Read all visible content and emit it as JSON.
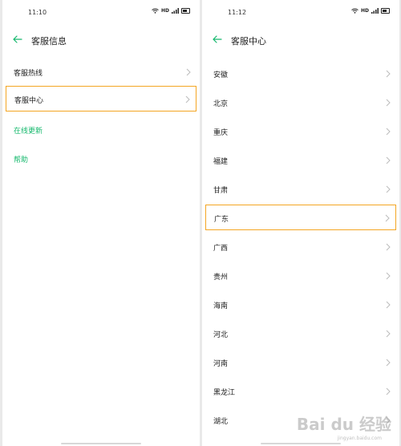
{
  "colors": {
    "accent": "#14b86c",
    "highlight_border": "#f4a623",
    "text": "#222222"
  },
  "left": {
    "status_time": "11:10",
    "status_network": "HD",
    "title": "客服信息",
    "items": [
      {
        "label": "客服热线",
        "chevron": true,
        "green": false
      },
      {
        "label": "客服中心",
        "chevron": true,
        "green": false,
        "highlighted": true
      },
      {
        "label": "在线更新",
        "chevron": false,
        "green": true
      },
      {
        "label": "帮助",
        "chevron": false,
        "green": true
      }
    ]
  },
  "right": {
    "status_time": "11:12",
    "status_network": "HD",
    "title": "客服中心",
    "items": [
      {
        "label": "安徽"
      },
      {
        "label": "北京"
      },
      {
        "label": "重庆"
      },
      {
        "label": "福建"
      },
      {
        "label": "甘肃"
      },
      {
        "label": "广东",
        "highlighted": true
      },
      {
        "label": "广西"
      },
      {
        "label": "贵州"
      },
      {
        "label": "海南"
      },
      {
        "label": "河北"
      },
      {
        "label": "河南"
      },
      {
        "label": "黑龙江"
      },
      {
        "label": "湖北"
      }
    ]
  },
  "watermark": {
    "brand": "Bai du 经验",
    "url": "jingyan.baidu.com"
  }
}
